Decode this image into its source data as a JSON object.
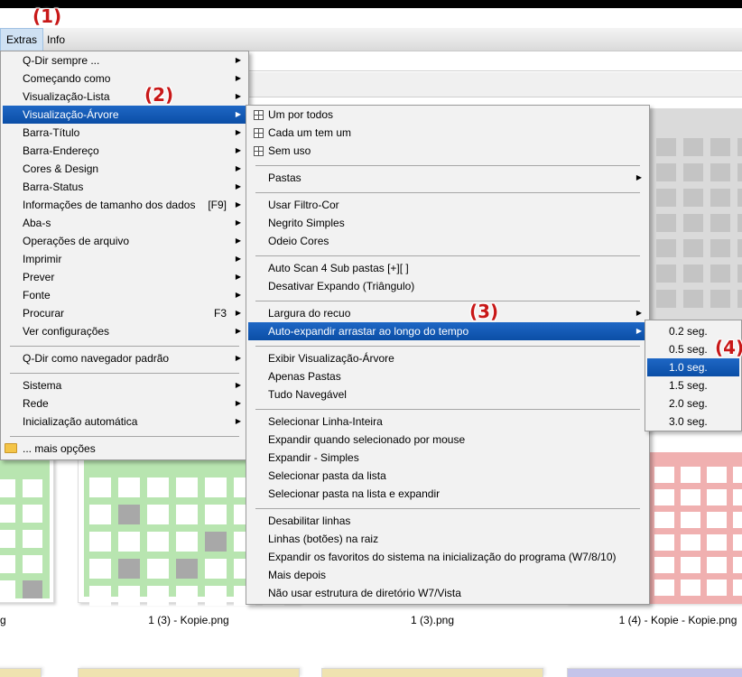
{
  "annotations": [
    "(1)",
    "(2)",
    "(3)",
    "(4)"
  ],
  "menubar": {
    "items": [
      "Extras",
      "Info"
    ]
  },
  "main_menu": {
    "items": [
      {
        "label": "Q-Dir sempre ...",
        "shortcut": "",
        "arrow": true
      },
      {
        "label": "Começando como",
        "shortcut": "",
        "arrow": true
      },
      {
        "label": "Visualização-Lista",
        "shortcut": "",
        "arrow": true
      },
      {
        "label": "Visualização-Árvore",
        "shortcut": "",
        "arrow": true,
        "selected": true
      },
      {
        "label": "Barra-Título",
        "shortcut": "",
        "arrow": true
      },
      {
        "label": "Barra-Endereço",
        "shortcut": "",
        "arrow": true
      },
      {
        "label": "Cores & Design",
        "shortcut": "",
        "arrow": true
      },
      {
        "label": "Barra-Status",
        "shortcut": "",
        "arrow": true
      },
      {
        "label": "Informações de tamanho dos dados",
        "shortcut": "[F9]",
        "arrow": true
      },
      {
        "label": "Aba-s",
        "shortcut": "",
        "arrow": true
      },
      {
        "label": "Operações de arquivo",
        "shortcut": "",
        "arrow": true
      },
      {
        "label": "Imprimir",
        "shortcut": "",
        "arrow": true
      },
      {
        "label": "Prever",
        "shortcut": "",
        "arrow": true
      },
      {
        "label": "Fonte",
        "shortcut": "",
        "arrow": true
      },
      {
        "label": "Procurar",
        "shortcut": "F3",
        "arrow": true
      },
      {
        "label": "Ver configurações",
        "shortcut": "",
        "arrow": true
      },
      {
        "label": "Q-Dir como navegador padrão",
        "shortcut": "",
        "arrow": true
      },
      {
        "label": "Sistema",
        "shortcut": "",
        "arrow": true
      },
      {
        "label": "Rede",
        "shortcut": "",
        "arrow": true
      },
      {
        "label": "Inicialização automática",
        "shortcut": "",
        "arrow": true
      },
      {
        "label": "... mais opções",
        "shortcut": "",
        "arrow": false,
        "icon": "folder-icon"
      }
    ]
  },
  "tree_menu": {
    "items": [
      {
        "label": "Um por todos",
        "arrow": false,
        "icon": "tree-radio-icon"
      },
      {
        "label": "Cada um tem um",
        "arrow": false,
        "icon": "tree-radio-icon"
      },
      {
        "label": "Sem uso",
        "arrow": false,
        "icon": "tree-radio-icon"
      },
      {
        "label": "Pastas",
        "arrow": true
      },
      {
        "label": "Usar Filtro-Cor",
        "arrow": false
      },
      {
        "label": "Negrito Simples",
        "arrow": false
      },
      {
        "label": "Odeio Cores",
        "arrow": false
      },
      {
        "label": "Auto Scan 4 Sub pastas [+][ ]",
        "arrow": false
      },
      {
        "label": "Desativar Expando (Triângulo)",
        "arrow": false
      },
      {
        "label": "Largura do recuo",
        "arrow": true
      },
      {
        "label": "Auto-expandir arrastar ao longo do tempo",
        "arrow": true,
        "selected": true
      },
      {
        "label": "Exibir Visualização-Árvore",
        "arrow": false
      },
      {
        "label": "Apenas Pastas",
        "arrow": false
      },
      {
        "label": "Tudo Navegável",
        "arrow": false
      },
      {
        "label": "Selecionar Linha-Inteira",
        "arrow": false
      },
      {
        "label": "Expandir quando selecionado por mouse",
        "arrow": false
      },
      {
        "label": "Expandir - Simples",
        "arrow": false
      },
      {
        "label": "Selecionar pasta da lista",
        "arrow": false
      },
      {
        "label": "Selecionar pasta na lista e expandir",
        "arrow": false
      },
      {
        "label": "Desabilitar linhas",
        "arrow": false
      },
      {
        "label": "Linhas (botões) na raiz",
        "arrow": false
      },
      {
        "label": "Expandir os favoritos do sistema na inicialização do programa (W7/8/10)",
        "arrow": false
      },
      {
        "label": "Mais depois",
        "arrow": false
      },
      {
        "label": "Não usar estrutura de diretório W7/Vista",
        "arrow": false
      }
    ]
  },
  "time_menu": {
    "items": [
      {
        "label": "0.2 seg."
      },
      {
        "label": "0.5 seg."
      },
      {
        "label": "1.0 seg.",
        "selected": true
      },
      {
        "label": "1.5 seg."
      },
      {
        "label": "2.0 seg."
      },
      {
        "label": "3.0 seg."
      }
    ]
  },
  "files": {
    "captions": [
      "1 (3) - Kopie.png",
      "1 (3).png",
      "1 (4) - Kopie - Kopie.png"
    ],
    "left_partial_caption": "g",
    "colors": {
      "green": "#b8e5b0",
      "gray": "#dadada",
      "pink": "#f0b0b0",
      "yellow": "#efe3b0",
      "lavender": "#c4c4ea"
    }
  }
}
